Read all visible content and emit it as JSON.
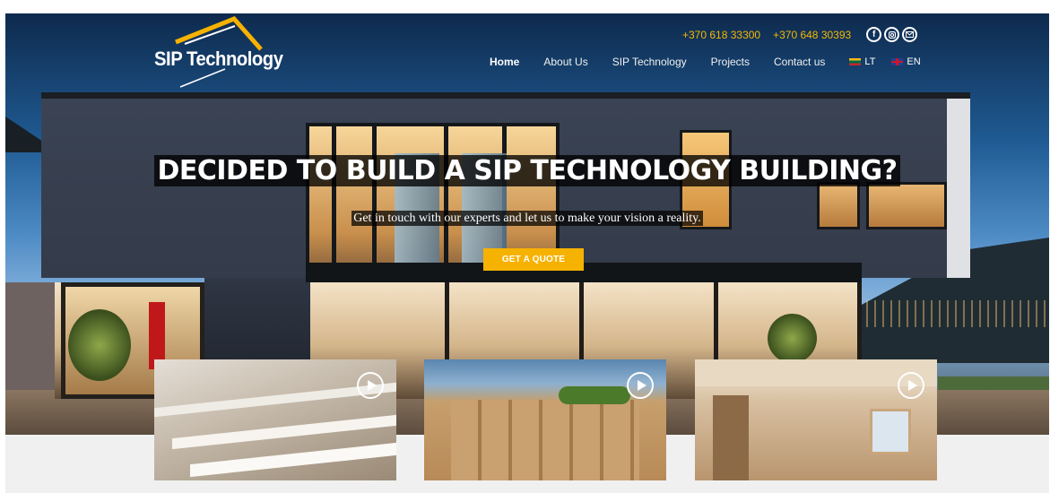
{
  "header": {
    "logo_text": "SIP Technology",
    "phones": [
      "+370 618 33300",
      "+370 648 30393"
    ],
    "social_icons": [
      "facebook-icon",
      "instagram-icon",
      "email-icon"
    ],
    "nav": [
      {
        "label": "Home",
        "active": true
      },
      {
        "label": "About Us",
        "active": false
      },
      {
        "label": "SIP Technology",
        "active": false
      },
      {
        "label": "Projects",
        "active": false
      },
      {
        "label": "Contact us",
        "active": false
      }
    ],
    "languages": [
      {
        "code": "LT",
        "flag": "lithuania-flag-icon"
      },
      {
        "code": "EN",
        "flag": "uk-flag-icon"
      }
    ]
  },
  "hero": {
    "headline": "DECIDED TO BUILD A SIP TECHNOLOGY BUILDING?",
    "subtitle": "Get in touch with our experts and let us to make your vision a reality.",
    "cta_label": "GET A QUOTE"
  },
  "video_cards": [
    {
      "icon": "play-icon"
    },
    {
      "icon": "play-icon"
    },
    {
      "icon": "play-icon"
    }
  ],
  "colors": {
    "accent": "#f6b200",
    "phone_text": "#f5b800",
    "headline_bg": "#000000"
  }
}
